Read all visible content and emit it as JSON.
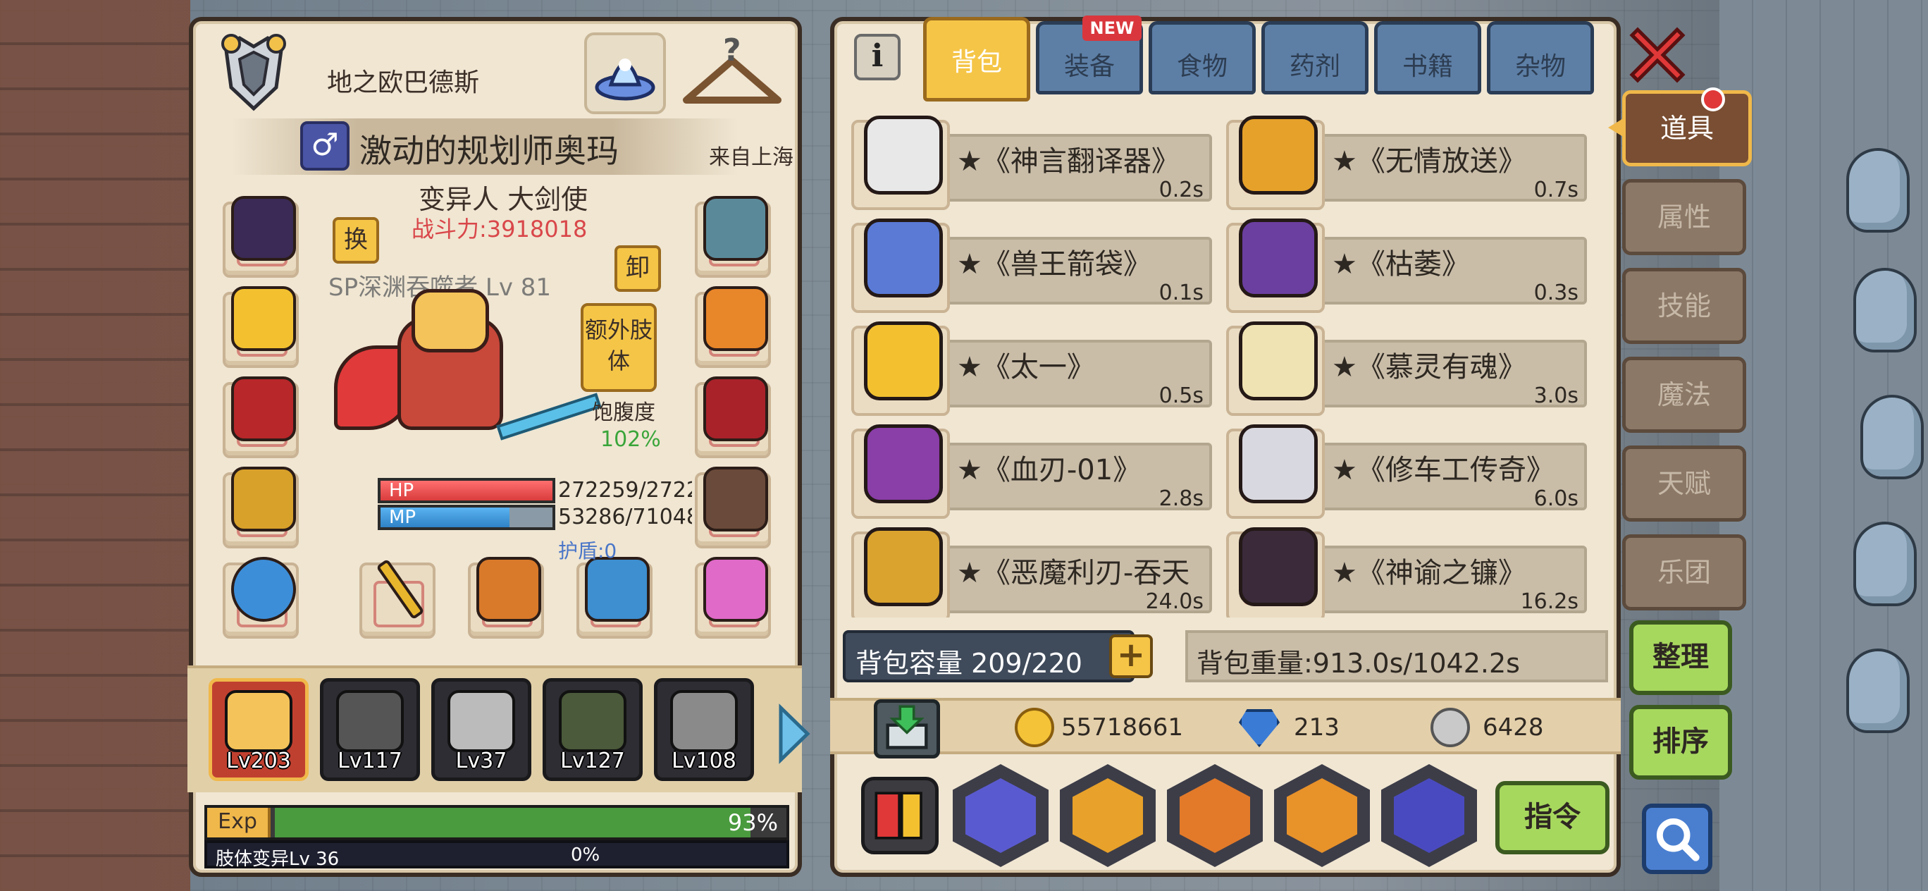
{
  "character": {
    "title": "地之欧巴德斯",
    "gender_symbol": "♂",
    "name": "激动的规划师奥玛",
    "origin": "来自上海",
    "class_name": "变异人 大剑使",
    "power": "战斗力:3918018",
    "swap_label": "换",
    "unequip_label": "卸",
    "extra_limb_label": "额外肢体",
    "pet_label": "SP深渊吞噬者 Lv 81",
    "satiety_label": "饱腹度",
    "satiety_value": "102%",
    "hp_label": "HP",
    "hp_value": "272259/2722",
    "hp_fraction": 1.0,
    "mp_label": "MP",
    "mp_value": "53286/71048",
    "mp_fraction": 0.75,
    "shield": "护盾:0"
  },
  "party": [
    {
      "level": "Lv203",
      "active": true
    },
    {
      "level": "Lv117",
      "active": false
    },
    {
      "level": "Lv37",
      "active": false
    },
    {
      "level": "Lv127",
      "active": false
    },
    {
      "level": "Lv108",
      "active": false
    }
  ],
  "exp": {
    "label": "Exp",
    "percent_text": "93%",
    "fraction": 0.93
  },
  "mutation": {
    "label": "肢体变异Lv 36",
    "percent_text": "0%"
  },
  "inventory": {
    "tabs": [
      {
        "label": "背包",
        "active": true
      },
      {
        "label": "装备",
        "active": false,
        "badge": "NEW"
      },
      {
        "label": "食物",
        "active": false
      },
      {
        "label": "药剂",
        "active": false
      },
      {
        "label": "书籍",
        "active": false
      },
      {
        "label": "杂物",
        "active": false
      }
    ],
    "items": [
      {
        "name": "★《神言翻译器》",
        "weight": "0.2s",
        "color": "#e8e8e8"
      },
      {
        "name": "★《无情放送》",
        "weight": "0.7s",
        "color": "#e6a12a"
      },
      {
        "name": "★《兽王箭袋》",
        "weight": "0.1s",
        "color": "#5a7ad6"
      },
      {
        "name": "★《枯萎》",
        "weight": "0.3s",
        "color": "#6b3fa0"
      },
      {
        "name": "★《太一》",
        "weight": "0.5s",
        "color": "#f3c130"
      },
      {
        "name": "★《慕灵有魂》",
        "weight": "3.0s",
        "color": "#efe3b3"
      },
      {
        "name": "★《血刃-01》",
        "weight": "2.8s",
        "color": "#8a3ea8"
      },
      {
        "name": "★《修车工传奇》",
        "weight": "6.0s",
        "color": "#d8d8e0"
      },
      {
        "name": "★《恶魔利刃-吞天",
        "weight": "24.0s",
        "color": "#d9a32e"
      },
      {
        "name": "★《神谕之镰》",
        "weight": "16.2s",
        "color": "#3a2a3a"
      }
    ],
    "capacity": "背包容量 209/220",
    "capacity_plus": "+",
    "weight": "背包重量:913.0s/1042.2s"
  },
  "currency": {
    "gold": "55718661",
    "gems": "213",
    "tokens": "6428"
  },
  "commands": {
    "order_label": "指令"
  },
  "side_menu": {
    "tabs": [
      {
        "label": "道具",
        "active": true
      },
      {
        "label": "属性",
        "active": false
      },
      {
        "label": "技能",
        "active": false
      },
      {
        "label": "魔法",
        "active": false
      },
      {
        "label": "天赋",
        "active": false
      },
      {
        "label": "乐团",
        "active": false
      }
    ],
    "organize_label": "整理",
    "sort_label": "排序"
  },
  "colors": {
    "panel": "#f0e6d2",
    "accent_gold": "#f5c547",
    "tab_blue": "#5d7fa6",
    "button_green": "#a7d85e",
    "hp_red": "#d93c3c",
    "mp_blue": "#2f82c6"
  }
}
